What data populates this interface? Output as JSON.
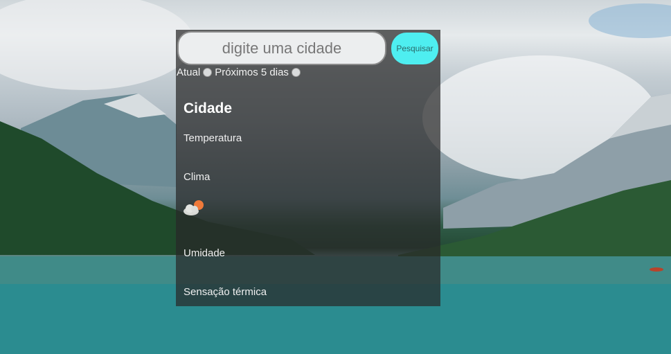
{
  "search": {
    "placeholder": "digite uma cidade",
    "button_label": "Pesquisar"
  },
  "options": {
    "current_label": "Atual",
    "forecast_label": "Próximos 5 dias"
  },
  "weather": {
    "city": "Cidade",
    "temperature_label": "Temperatura",
    "climate_label": "Clima",
    "icon": "partly-cloudy-icon",
    "humidity_label": "Umidade",
    "feels_like_label": "Sensação térmica"
  },
  "colors": {
    "button": "#4eeef0",
    "panel": "rgba(40,40,40,0.72)"
  }
}
